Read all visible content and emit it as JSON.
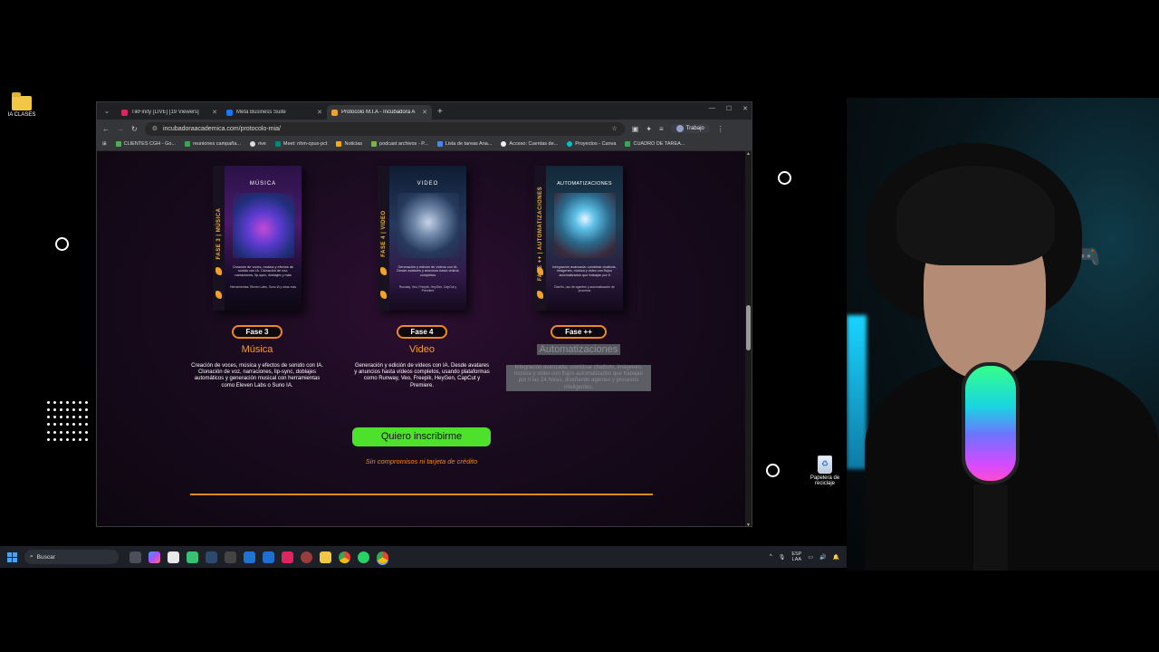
{
  "desktop": {
    "folder_label": "IA CLASES",
    "recycle_label": "Papelera de reciclaje"
  },
  "browser": {
    "tabs": [
      {
        "title": "TikFinity [LIVE] [19 Viewers]",
        "color": "#e0245e"
      },
      {
        "title": "Meta Business Suite",
        "color": "#1877f2"
      },
      {
        "title": "Protocolo M.I.A - Incubadora A",
        "color": "#f0a22b"
      }
    ],
    "url": "incubadoraacademica.com/protocolo-mia/",
    "profile_label": "Trabajo",
    "bookmarks": [
      "CLIENTES CGH - Go...",
      "reuniones campaña...",
      "rive",
      "Meet: nhm-cpux-pct",
      "Noticias",
      "podcast archivos - P...",
      "Lista de tareas Ana...",
      "Acceso: Cuentas de...",
      "Proyectos - Canva",
      "CUADRO DE TAREA..."
    ]
  },
  "page": {
    "cards": [
      {
        "spine": "FASE 3 | MÚSICA",
        "cover_title": "MÚSICA",
        "blurb": "Creación de voces, música y efectos de sonido con IA. Clonación de voz, narraciones, lip-sync, doblajes y más",
        "blurb2": "Herramientas: Eleven Labs, Suno IA y otras más",
        "phase": "Fase 3",
        "title": "Música",
        "desc": "Creación de voces, música y efectos de sonido con IA. Clonación de voz, narraciones, lip-sync, doblajes automáticos y generación musical con herramientas como Eleven Labs o Suno IA."
      },
      {
        "spine": "FASE 4 | VIDEO",
        "cover_title": "VIDEO",
        "blurb": "Generación y edición de vídeos con IA. Desde avatares y anuncios hasta vídeos completos",
        "blurb2": "Runway, Veo, Freepik, HeyGen, CapCut y Premiere",
        "phase": "Fase 4",
        "title": "Video",
        "desc": "Generación y edición de vídeos con IA. Desde avatares y anuncios hasta vídeos completos, usando plataformas como Runway, Veo, Freepik, HeyGen, CapCut y Premiere."
      },
      {
        "spine": "FASE ++ | AUTOMATIZACIONES",
        "cover_title": "AUTOMATIZACIONES",
        "blurb": "Integración avanzada: combinar chatbots, imágenes, música y video con flujos automatizados que trabajan por ti",
        "blurb2": "Diseño, uso de agentes y automatización de procesos",
        "phase": "Fase ++",
        "title": "Automatizaciones",
        "desc": "Integración avanzada: combinar chatbots, imágenes, música y video con flujos automatizados que trabajan por ti las 24 horas, diseñando agentes y procesos inteligentes."
      }
    ],
    "cta_label": "Quiero inscribirme",
    "cta_sub": "Sin compromisos ni tarjeta de crédito"
  },
  "taskbar": {
    "search_placeholder": "Buscar",
    "lang_top": "ESP",
    "lang_bottom": "LAA"
  },
  "colors": {
    "accent_orange": "#f08a1e",
    "cta_green": "#4ee12b",
    "page_bg": "#1a0b1f"
  }
}
